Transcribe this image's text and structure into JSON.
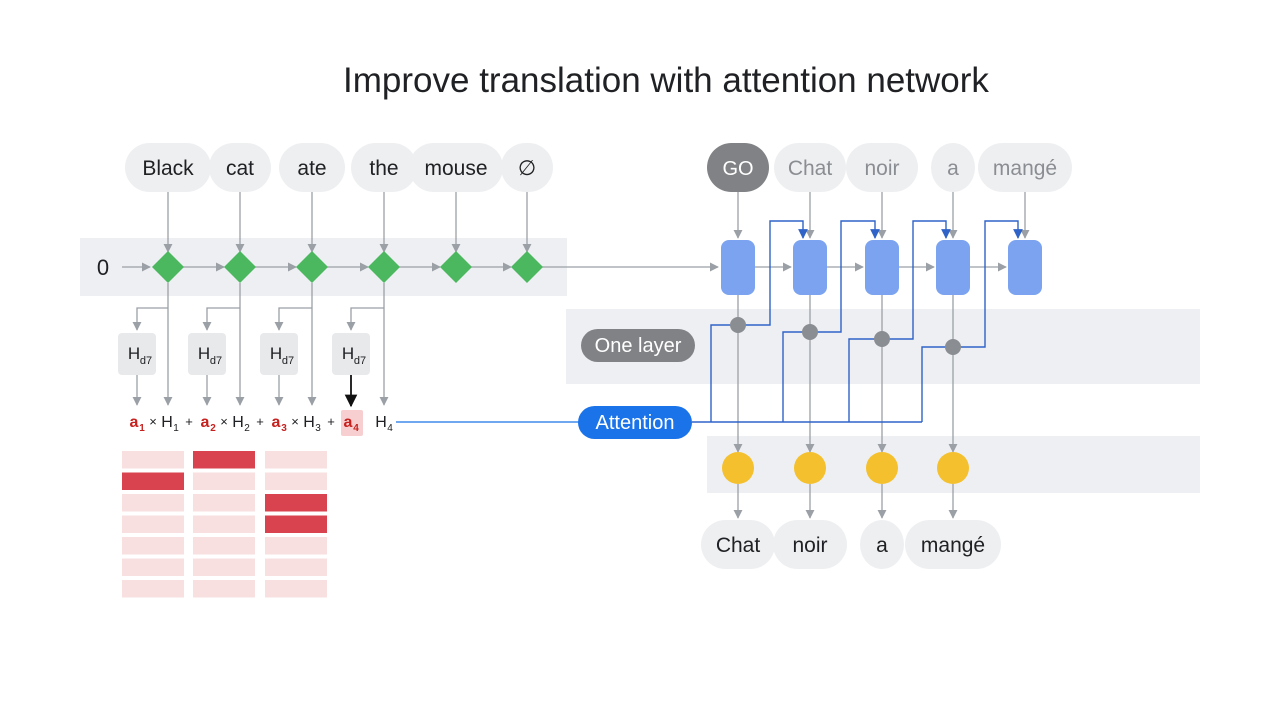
{
  "title": "Improve translation with attention network",
  "encoder": {
    "initial_state": "0",
    "input_words": [
      "Black",
      "cat",
      "ate",
      "the",
      "mouse",
      "∅"
    ],
    "node_color": "#4bb85f",
    "hidden_label": "H",
    "hidden_label_sub": "d7"
  },
  "equation": {
    "terms": [
      {
        "weight": "a",
        "weight_sub": "1",
        "op": "×",
        "state": "H",
        "state_sub": "1",
        "joiner": "+"
      },
      {
        "weight": "a",
        "weight_sub": "2",
        "op": "×",
        "state": "H",
        "state_sub": "2",
        "joiner": "+"
      },
      {
        "weight": "a",
        "weight_sub": "3",
        "op": "×",
        "state": "H",
        "state_sub": "3",
        "joiner": "+"
      },
      {
        "weight": "a",
        "weight_sub": "4",
        "op": "",
        "state": "H",
        "state_sub": "4",
        "joiner": ""
      }
    ],
    "highlight_term": 4
  },
  "attention_matrix": {
    "columns": 3,
    "rows": 7,
    "active_cells": [
      [
        1,
        0
      ],
      [
        0,
        1
      ],
      [
        2,
        2
      ],
      [
        3,
        2
      ]
    ],
    "active_color": "#d9434f",
    "inactive_color": "#f8dfe0"
  },
  "decoder": {
    "input_words": [
      "GO",
      "Chat",
      "noir",
      "a",
      "mangé"
    ],
    "start_token": "GO",
    "cell_color": "#7ba3f0",
    "output_words": [
      "Chat",
      "noir",
      "a",
      "mangé"
    ],
    "output_node_color": "#f4c02d"
  },
  "labels": {
    "one_layer": "One layer",
    "attention": "Attention"
  },
  "colors": {
    "attention_blue": "#1a73e8",
    "connector_blue": "#2f63c8",
    "pill_gray": "#eeeff1",
    "band_gray": "#eeeff2",
    "dark_pill": "#808285",
    "arrow_gray": "#9aa0a6"
  }
}
